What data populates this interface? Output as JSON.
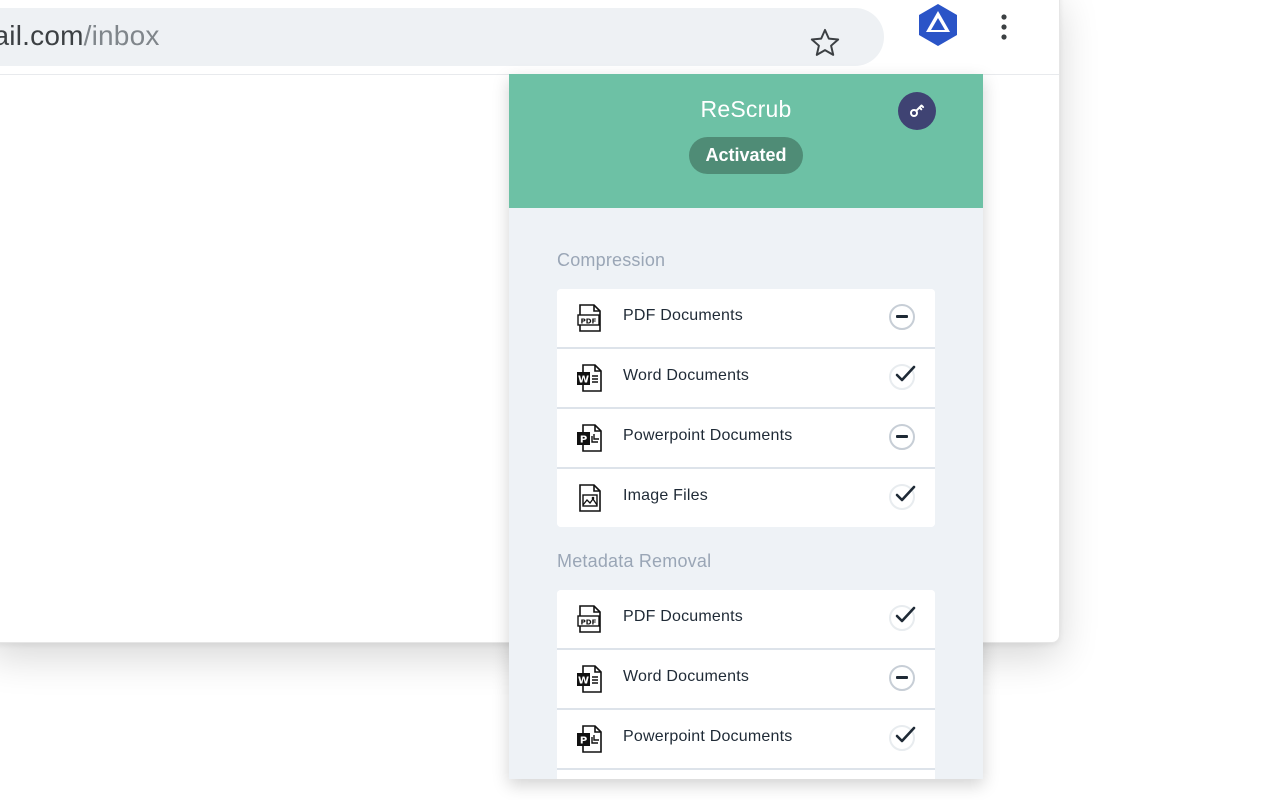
{
  "browser": {
    "url_domain": "mail.com",
    "url_path": "/inbox"
  },
  "extension": {
    "title": "ReScrub",
    "status": "Activated",
    "header_color": "#6dc1a5",
    "accent_color": "#3f4373",
    "sections": [
      {
        "title": "Compression",
        "items": [
          {
            "label": "PDF Documents",
            "icon": "pdf-icon",
            "enabled": false
          },
          {
            "label": "Word Documents",
            "icon": "word-icon",
            "enabled": true
          },
          {
            "label": "Powerpoint Documents",
            "icon": "powerpoint-icon",
            "enabled": false
          },
          {
            "label": "Image Files",
            "icon": "image-file-icon",
            "enabled": true
          }
        ]
      },
      {
        "title": "Metadata Removal",
        "items": [
          {
            "label": "PDF Documents",
            "icon": "pdf-icon",
            "enabled": true
          },
          {
            "label": "Word Documents",
            "icon": "word-icon",
            "enabled": false
          },
          {
            "label": "Powerpoint Documents",
            "icon": "powerpoint-icon",
            "enabled": true
          }
        ]
      }
    ]
  }
}
